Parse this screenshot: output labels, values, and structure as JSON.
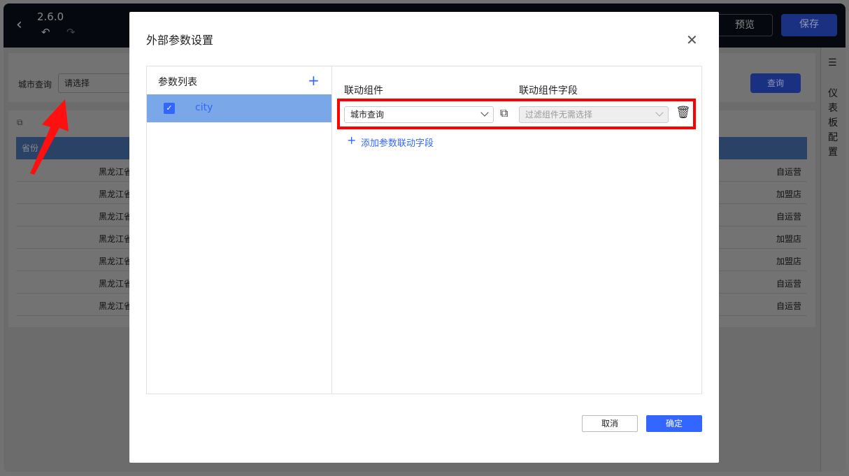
{
  "header": {
    "version": "2.6.0",
    "preview_label": "预览",
    "save_label": "保存"
  },
  "filter": {
    "label": "城市查询",
    "placeholder": "请选择",
    "query_label": "查询"
  },
  "table": {
    "header": "省份",
    "rows": [
      {
        "province": "黑龙江省",
        "type": "自运营"
      },
      {
        "province": "黑龙江省",
        "type": "加盟店"
      },
      {
        "province": "黑龙江省",
        "type": "自运营"
      },
      {
        "province": "黑龙江省",
        "type": "加盟店"
      },
      {
        "province": "黑龙江省",
        "type": "加盟店"
      },
      {
        "province": "黑龙江省",
        "type": "自运营"
      },
      {
        "province": "黑龙江省",
        "type": "自运营"
      }
    ]
  },
  "sidebar": {
    "label": "仪表板配置"
  },
  "modal": {
    "title": "外部参数设置",
    "param_list_title": "参数列表",
    "params": [
      {
        "name": "city",
        "checked": true
      }
    ],
    "col_component": "联动组件",
    "col_field": "联动组件字段",
    "component_value": "城市查询",
    "field_placeholder": "过滤组件无需选择",
    "add_link": "添加参数联动字段",
    "cancel": "取消",
    "ok": "确定"
  },
  "colors": {
    "primary": "#3366ff",
    "highlight": "#ff0000",
    "selected_row": "#7aa7e8"
  }
}
